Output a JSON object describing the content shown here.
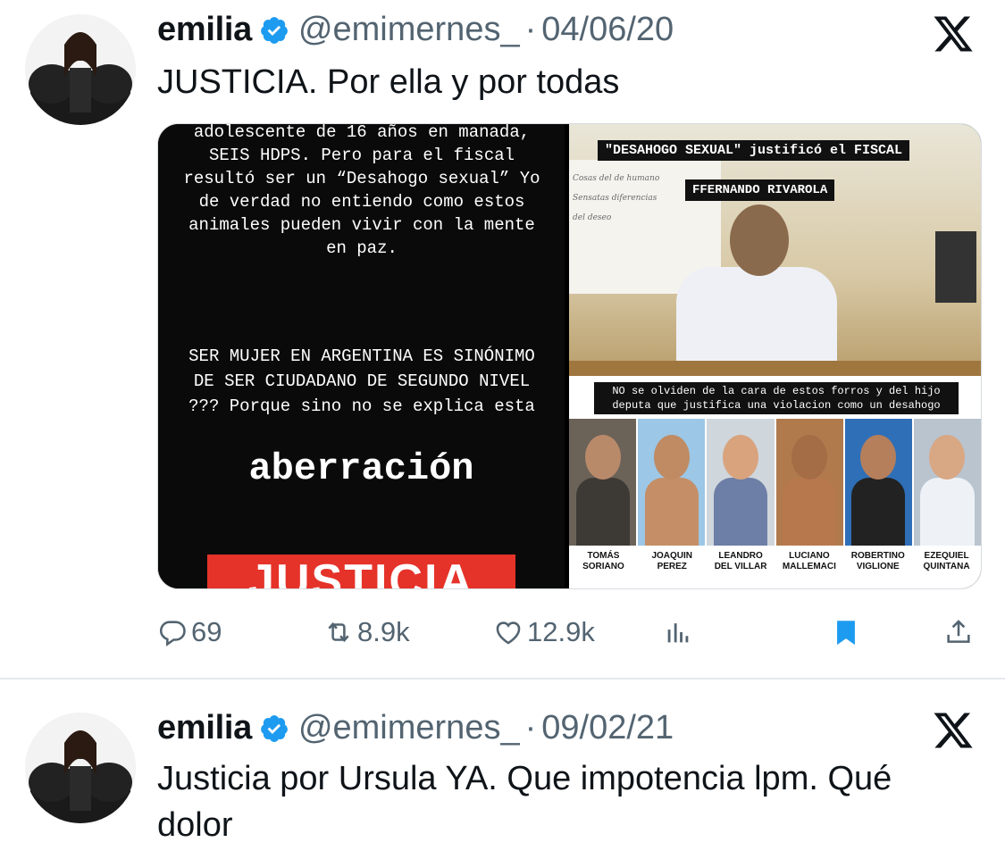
{
  "tweets": [
    {
      "author": {
        "name": "emilia",
        "handle": "@emimernes_",
        "verified": true
      },
      "separator": "·",
      "date": "04/06/20",
      "text": "JUSTICIA. Por ella y por todas",
      "media": {
        "left_panel": {
          "paragraph1": "adolescente de 16 años en manada, SEIS HDPS. Pero para el fiscal resultó ser un “Desahogo sexual” Yo de verdad no entiendo como estos animales pueden vivir con la mente en paz.",
          "paragraph2": "SER MUJER EN ARGENTINA ES SINÓNIMO DE SER CIUDADANO DE SEGUNDO NIVEL ??? Porque sino no se explica esta",
          "big_word": "aberración",
          "banner": "JUSTICIA"
        },
        "right_panel": {
          "caption_top": "\"DESAHOGO SEXUAL\" justificó el FISCAL",
          "caption_name": "FFERNANDO RIVAROLA",
          "wall_text": [
            "Cosas del de humano",
            "Sensatas diferencias",
            "del deseo"
          ],
          "caption_bottom": "NO se olviden de la cara de estos forros y del hijo deputa que justifica una violacion como un desahogo",
          "faces": [
            {
              "label": "TOMÁS\nSORIANO"
            },
            {
              "label": "JOAQUIN\nPEREZ"
            },
            {
              "label": "LEANDRO\nDEL VILLAR"
            },
            {
              "label": "LUCIANO\nMALLEMACI"
            },
            {
              "label": "ROBERTINO\nVIGLIONE"
            },
            {
              "label": "EZEQUIEL\nQUINTANA"
            }
          ]
        }
      },
      "actions": {
        "replies": "69",
        "reposts": "8.9k",
        "likes": "12.9k"
      }
    },
    {
      "author": {
        "name": "emilia",
        "handle": "@emimernes_",
        "verified": true
      },
      "separator": "·",
      "date": "09/02/21",
      "text": "Justicia por Ursula YA. Que impotencia lpm. Qué dolor"
    }
  ],
  "colors": {
    "text": "#0f1419",
    "muted": "#536471",
    "verified": "#1d9bf0",
    "bookmark_active": "#1d9bf0",
    "divider": "#e6e9ec",
    "banner": "#e5332a"
  },
  "icons": [
    "verified-badge-icon",
    "x-logo-icon",
    "reply-icon",
    "repost-icon",
    "like-icon",
    "views-icon",
    "bookmark-icon",
    "share-icon"
  ]
}
